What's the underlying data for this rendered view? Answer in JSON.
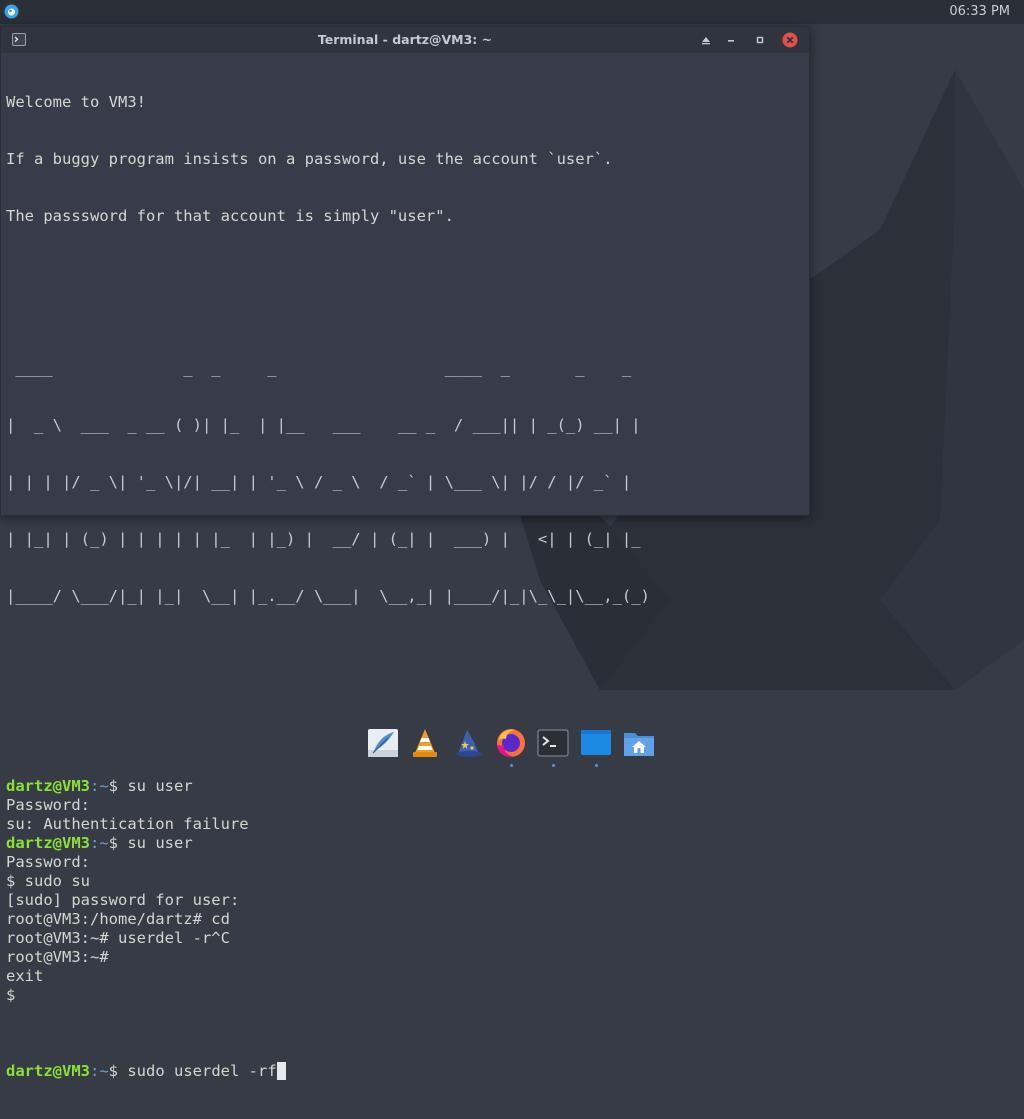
{
  "top_panel": {
    "clock": "06:33 PM",
    "app_menu_icon": "app-menu-icon"
  },
  "window": {
    "title": "Terminal - dartz@VM3: ~",
    "buttons": [
      "up-arrow-icon",
      "minimize-icon",
      "maximize-icon",
      "close-icon"
    ],
    "title_icon": "terminal-icon"
  },
  "terminal": {
    "welcome": [
      "Welcome to VM3!",
      "If a buggy program insists on a password, use the account `user`.",
      "The passsword for that account is simply \"user\"."
    ],
    "banner": [
      " ____              _  _     _                  ____  _       _    _ ",
      "|  _ \\  ___  _ __ ( )| |_  | |__   ___    __ _  / ___|| | _(_) __| |",
      "| | | |/ _ \\| '_ \\|/| __| | '_ \\ / _ \\  / _` | \\___ \\| |/ / |/ _` |",
      "| |_| | (_) | | | | | |_  | |_) |  __/ | (_| |  ___) |   <| | (_| |_",
      "|____/ \\___/|_| |_|  \\__| |_.__/ \\___|  \\__,_| |____/|_|\\_\\_|\\__,_(_)"
    ],
    "prompt_user": "dartz@VM3",
    "prompt_path": ":~",
    "prompt_suffix": "$ ",
    "session": [
      {
        "type": "prompt",
        "cmd": "su user"
      },
      {
        "type": "out",
        "text": "Password:"
      },
      {
        "type": "out",
        "text": "su: Authentication failure"
      },
      {
        "type": "prompt",
        "cmd": "su user"
      },
      {
        "type": "out",
        "text": "Password:"
      },
      {
        "type": "out",
        "text": "$ sudo su"
      },
      {
        "type": "out",
        "text": "[sudo] password for user:"
      },
      {
        "type": "out",
        "text": "root@VM3:/home/dartz# cd"
      },
      {
        "type": "out",
        "text": "root@VM3:~# userdel -r^C"
      },
      {
        "type": "out",
        "text": "root@VM3:~#"
      },
      {
        "type": "out",
        "text": "exit"
      },
      {
        "type": "out",
        "text": "$"
      }
    ],
    "current_command": "sudo userdel -rf"
  },
  "dock": {
    "items": [
      {
        "name": "text-editor-feather-icon"
      },
      {
        "name": "vlc-cone-icon"
      },
      {
        "name": "wizard-hat-icon"
      },
      {
        "name": "firefox-icon"
      },
      {
        "name": "terminal-icon"
      },
      {
        "name": "blue-window-icon"
      },
      {
        "name": "home-folder-icon"
      }
    ]
  },
  "colors": {
    "accent": "#5294e2",
    "prompt_user": "#8ae234",
    "prompt_path": "#729fcf",
    "close_button": "#e2504b",
    "desktop_bg": "#363b45"
  }
}
